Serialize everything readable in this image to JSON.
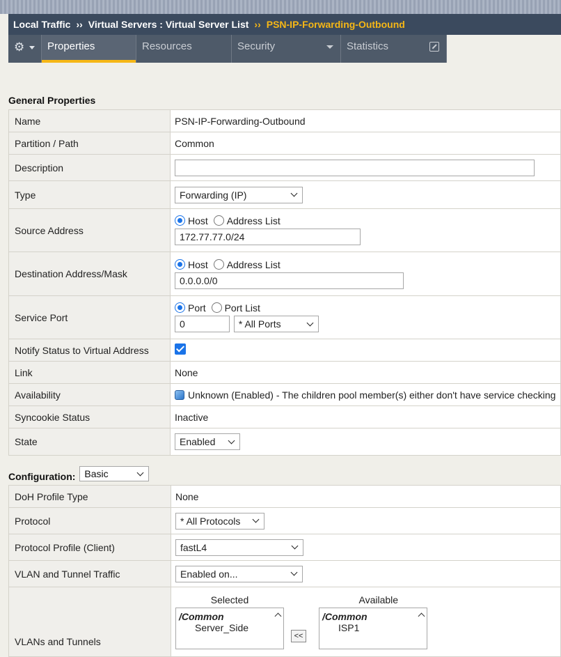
{
  "breadcrumb": {
    "part1": "Local Traffic",
    "part2": "Virtual Servers : Virtual Server List",
    "current": "PSN-IP-Forwarding-Outbound",
    "separator": "››"
  },
  "tabs": {
    "gear_icon": "gear-icon",
    "properties": "Properties",
    "resources": "Resources",
    "security": "Security",
    "statistics": "Statistics"
  },
  "general": {
    "title": "General Properties",
    "name_label": "Name",
    "name_value": "PSN-IP-Forwarding-Outbound",
    "partition_label": "Partition / Path",
    "partition_value": "Common",
    "description_label": "Description",
    "description_value": "",
    "type_label": "Type",
    "type_value": "Forwarding (IP)",
    "source_label": "Source Address",
    "source_opt_host": "Host",
    "source_opt_list": "Address List",
    "source_value": "172.77.77.0/24",
    "dest_label": "Destination Address/Mask",
    "dest_opt_host": "Host",
    "dest_opt_list": "Address List",
    "dest_value": "0.0.0.0/0",
    "port_label": "Service Port",
    "port_opt_port": "Port",
    "port_opt_list": "Port List",
    "port_value": "0",
    "port_select": "* All Ports",
    "notify_label": "Notify Status to Virtual Address",
    "link_label": "Link",
    "link_value": "None",
    "availability_label": "Availability",
    "availability_value": "Unknown (Enabled) - The children pool member(s) either don't have service checking enabled",
    "syncookie_label": "Syncookie Status",
    "syncookie_value": "Inactive",
    "state_label": "State",
    "state_value": "Enabled"
  },
  "configuration": {
    "title": "Configuration:",
    "mode": "Basic",
    "doh_label": "DoH Profile Type",
    "doh_value": "None",
    "protocol_label": "Protocol",
    "protocol_value": "* All Protocols",
    "profile_label": "Protocol Profile (Client)",
    "profile_value": "fastL4",
    "vlan_traffic_label": "VLAN and Tunnel Traffic",
    "vlan_traffic_value": "Enabled on...",
    "vlans_label": "VLANs and Tunnels",
    "selected_label": "Selected",
    "available_label": "Available",
    "selected_group": "/Common",
    "selected_item": "Server_Side",
    "available_group": "/Common",
    "available_item": "ISP1",
    "move_button": "<<"
  }
}
